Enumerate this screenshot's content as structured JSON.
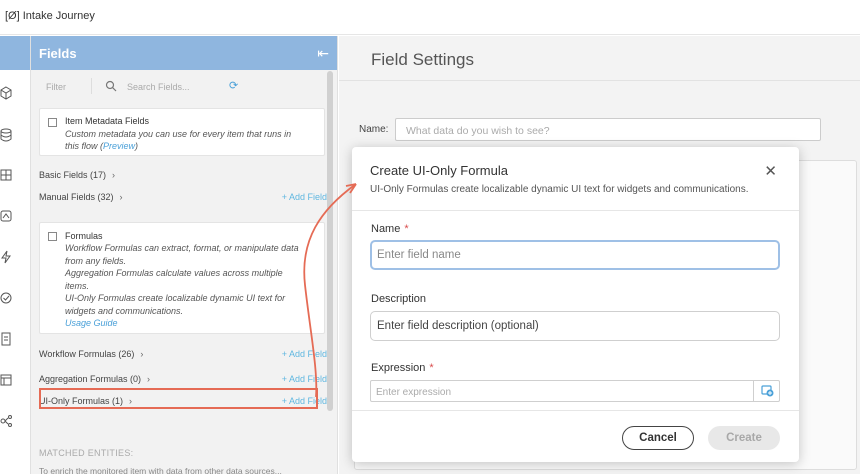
{
  "app": {
    "title": "[Ø] Intake Journey"
  },
  "rail": {
    "icons": [
      "cube-icon",
      "database-icon",
      "grid-icon",
      "flow-icon",
      "bolt-icon",
      "check-icon",
      "document-icon",
      "layout-icon",
      "network-icon"
    ]
  },
  "fields_panel": {
    "title": "Fields",
    "filter_label": "Filter",
    "search_placeholder": "Search Fields...",
    "item_metadata": {
      "title": "Item Metadata Fields",
      "desc_line1": "Custom metadata you can use for every item that runs in",
      "desc_line2_pre": "this flow (",
      "desc_line2_link": "Preview",
      "desc_line2_post": ")"
    },
    "basic_fields": "Basic Fields (17)",
    "manual_fields": "Manual Fields (32)",
    "add_field": "+ Add Field",
    "formulas": {
      "title": "Formulas",
      "lines": [
        "Workflow Formulas can extract, format, or manipulate data",
        "from any fields.",
        "Aggregation Formulas calculate values across multiple",
        "items.",
        "UI-Only Formulas create localizable dynamic UI text for",
        "widgets and communications."
      ],
      "usage_guide": "Usage Guide"
    },
    "workflow_formulas": "Workflow Formulas (26)",
    "aggregation_formulas": "Aggregation Formulas (0)",
    "ui_only_formulas": "UI-Only Formulas (1)",
    "matched_entities": "MATCHED ENTITIES:",
    "matched_desc": "To enrich the monitored item with data from other data sources..."
  },
  "settings": {
    "title": "Field Settings",
    "name_label": "Name:",
    "name_placeholder": "What data do you wish to see?"
  },
  "modal": {
    "title": "Create UI-Only Formula",
    "subtitle": "UI-Only Formulas create localizable dynamic UI text for widgets and communications.",
    "name_label": "Name",
    "name_placeholder": "Enter field name",
    "description_label": "Description",
    "description_placeholder": "Enter field description (optional)",
    "expression_label": "Expression",
    "expression_placeholder": "Enter expression",
    "required_mark": "*",
    "cancel_label": "Cancel",
    "create_label": "Create"
  },
  "colors": {
    "accent": "#8fb6df",
    "link": "#4aa0d8",
    "highlight": "#e56b55"
  }
}
